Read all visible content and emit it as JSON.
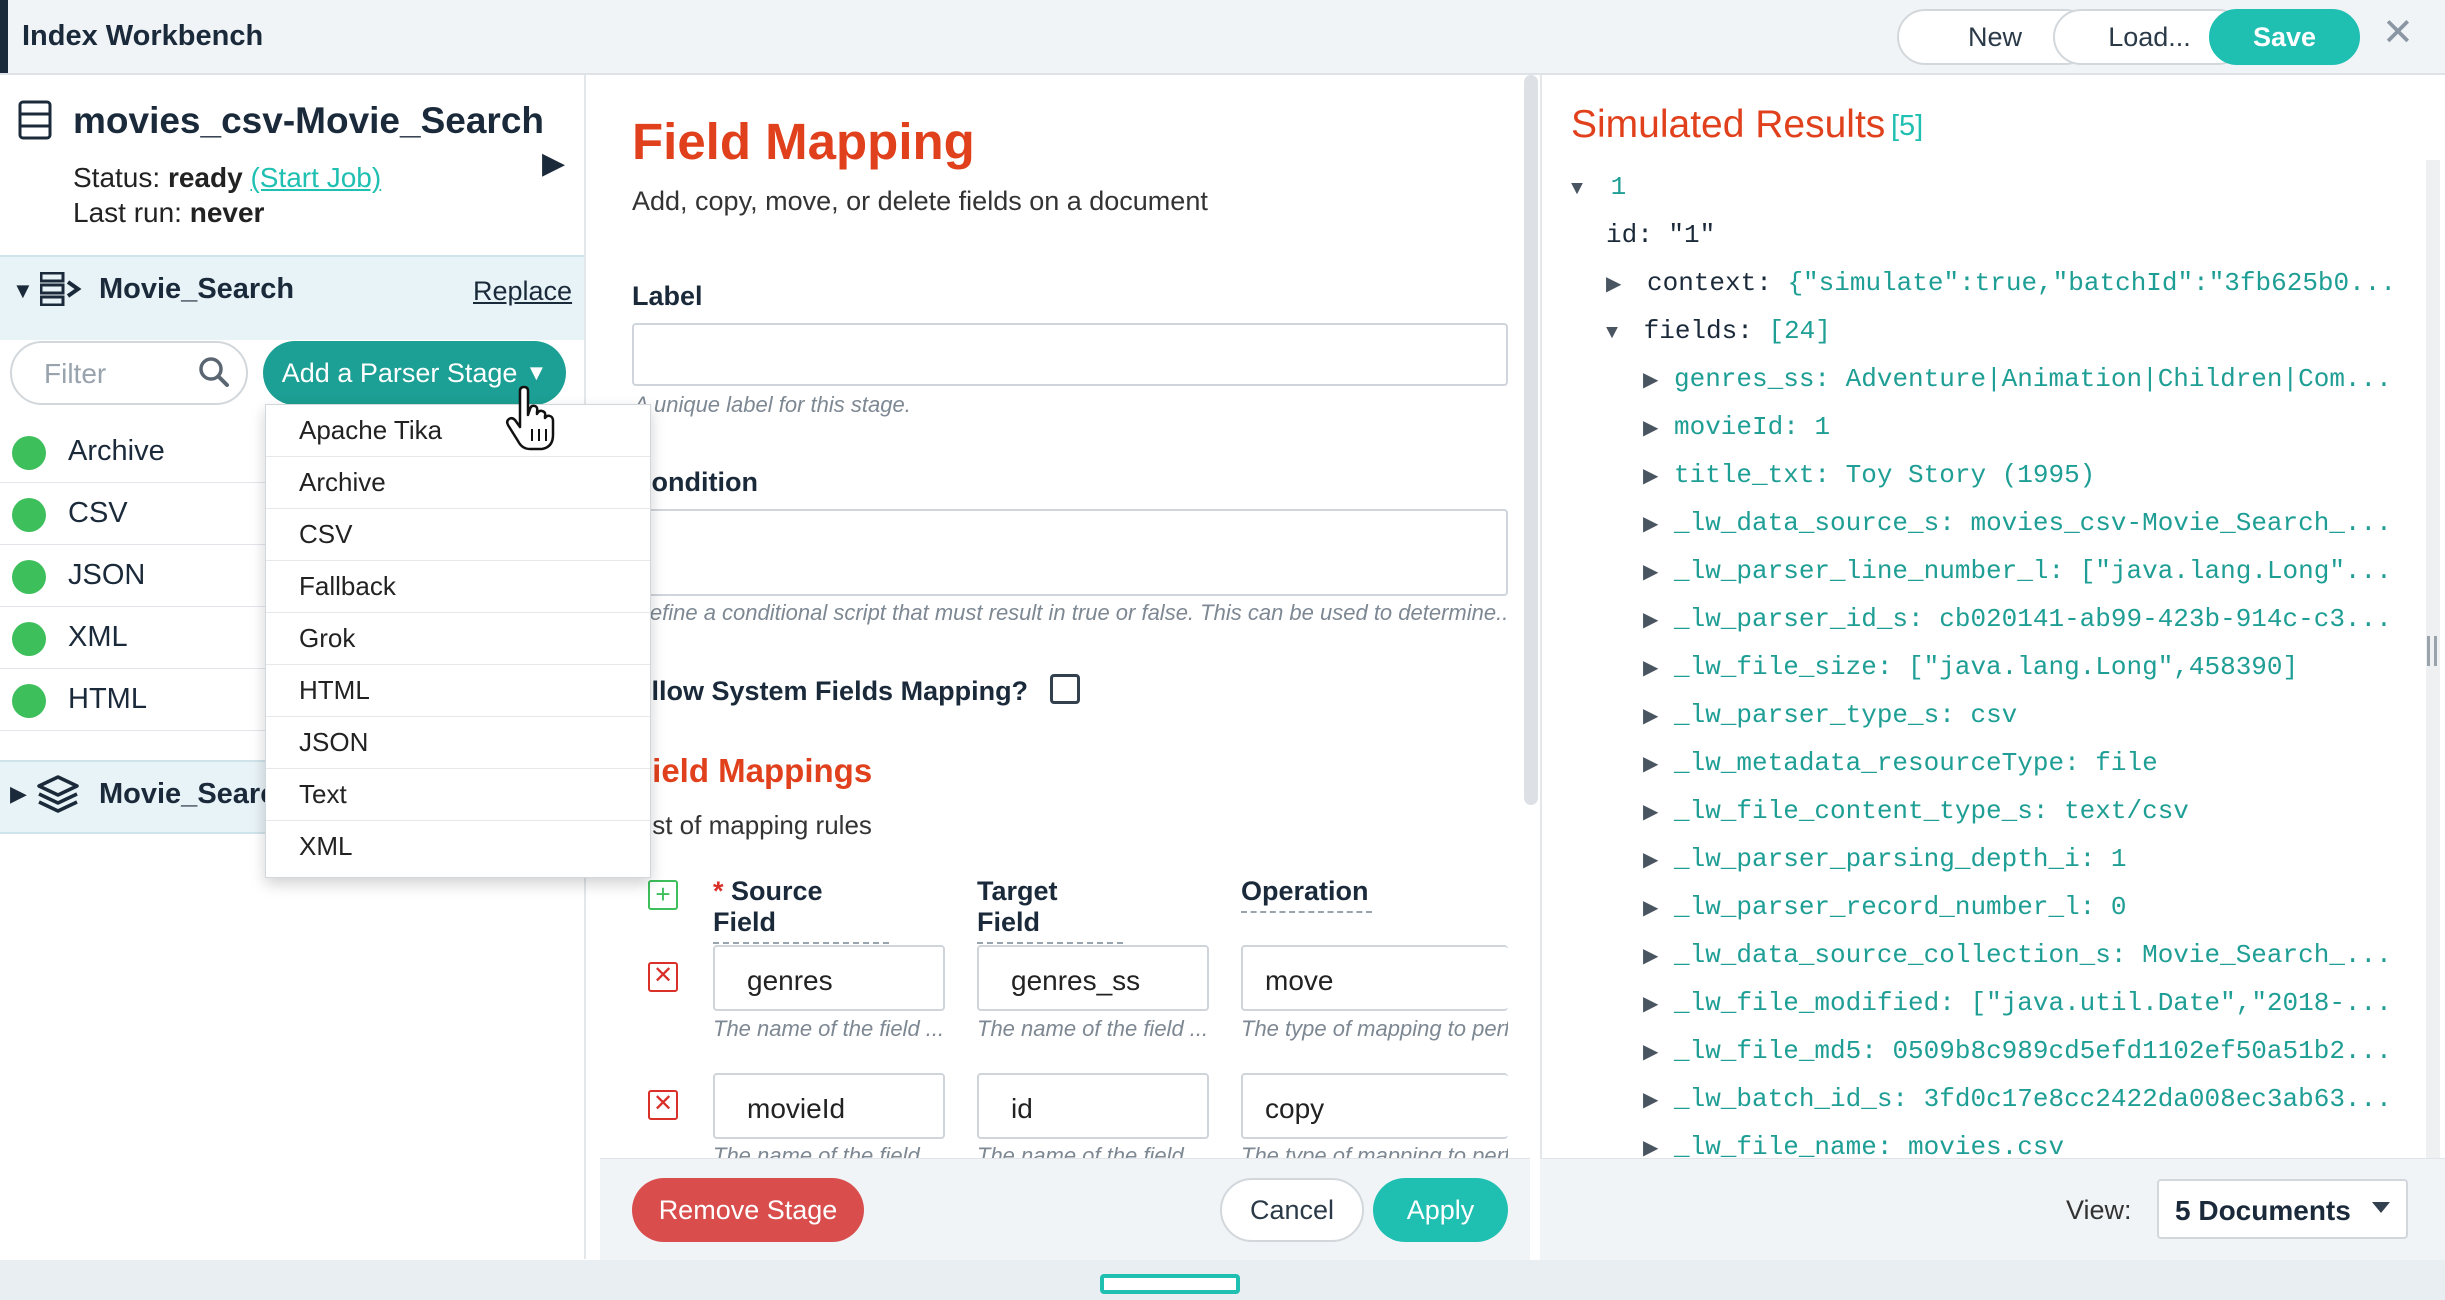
{
  "app": {
    "title": "Index Workbench"
  },
  "toolbar": {
    "new_label": "New",
    "load_label": "Load...",
    "save_label": "Save",
    "close_glyph": "✕"
  },
  "pipeline": {
    "name": "movies_csv-Movie_Search",
    "status_label": "Status:",
    "status_value": "ready",
    "start_job_link": "(Start Job)",
    "last_run_label": "Last run:",
    "last_run_value": "never",
    "collapse_glyph": "▶"
  },
  "parser_stage": {
    "name": "Movie_Search",
    "replace_label": "Replace",
    "filter_placeholder": "Filter",
    "add_button_label": "Add a Parser Stage",
    "items": [
      "Archive",
      "CSV",
      "JSON",
      "XML",
      "HTML"
    ],
    "item_status_color": "#3dbf5b"
  },
  "index_stage": {
    "name": "Movie_Search"
  },
  "dropdown": {
    "options": [
      "Apache Tika",
      "Archive",
      "CSV",
      "Fallback",
      "Grok",
      "HTML",
      "JSON",
      "Text",
      "XML"
    ]
  },
  "field_mapping": {
    "title": "Field Mapping",
    "subtitle": "Add, copy, move, or delete fields on a document",
    "label_field": {
      "label": "Label",
      "value": "",
      "hint": "A unique label for this stage."
    },
    "condition_field": {
      "label": "Condition",
      "value": "",
      "hint": "Define a conditional script that must result in true or false. This can be used to determine..."
    },
    "system_fields_label": "Allow System Fields Mapping?",
    "system_fields_checked": false,
    "mappings_heading": "Field Mappings",
    "mappings_subtitle": "List of mapping rules",
    "columns": {
      "required_mark": "*",
      "source": "Source Field",
      "target": "Target Field",
      "operation": "Operation"
    },
    "rows": [
      {
        "source": "genres",
        "target": "genres_ss",
        "operation": "move",
        "source_hint": "The name of the field ...",
        "target_hint": "The name of the field ...",
        "operation_hint": "The type of mapping to perform"
      },
      {
        "source": "movieId",
        "target": "id",
        "operation": "copy",
        "source_hint": "The name of the field",
        "target_hint": "The name of the field",
        "operation_hint": "The type of mapping to perform"
      }
    ],
    "remove_label": "Remove Stage",
    "cancel_label": "Cancel",
    "apply_label": "Apply"
  },
  "simulated": {
    "title": "Simulated Results",
    "count": "[5]",
    "doc_index": "1",
    "id_line": {
      "key": "id:",
      "value": "\"1\""
    },
    "context_line": {
      "key": "context:",
      "value": "{\"simulate\":true,\"batchId\":\"3fb625b0..."
    },
    "fields_line": {
      "key": "fields:",
      "value": "[24]"
    },
    "fields": [
      {
        "key": "genres_ss:",
        "value": "Adventure|Animation|Children|Com..."
      },
      {
        "key": "movieId:",
        "value": "1"
      },
      {
        "key": "title_txt:",
        "value": "Toy Story (1995)"
      },
      {
        "key": "_lw_data_source_s:",
        "value": "movies_csv-Movie_Search_..."
      },
      {
        "key": "_lw_parser_line_number_l:",
        "value": "[\"java.lang.Long\"..."
      },
      {
        "key": "_lw_parser_id_s:",
        "value": "cb020141-ab99-423b-914c-c3..."
      },
      {
        "key": "_lw_file_size:",
        "value": "[\"java.lang.Long\",458390]"
      },
      {
        "key": "_lw_parser_type_s:",
        "value": "csv"
      },
      {
        "key": "_lw_metadata_resourceType:",
        "value": "file"
      },
      {
        "key": "_lw_file_content_type_s:",
        "value": "text/csv"
      },
      {
        "key": "_lw_parser_parsing_depth_i:",
        "value": "1"
      },
      {
        "key": "_lw_parser_record_number_l:",
        "value": "0"
      },
      {
        "key": "_lw_data_source_collection_s:",
        "value": "Movie_Search_..."
      },
      {
        "key": "_lw_file_modified:",
        "value": "[\"java.util.Date\",\"2018-..."
      },
      {
        "key": "_lw_file_md5:",
        "value": "0509b8c989cd5efd1102ef50a51b2..."
      },
      {
        "key": "_lw_batch_id_s:",
        "value": "3fd0c17e8cc2422da008ec3ab63..."
      },
      {
        "key": "_lw_file_name:",
        "value": "movies.csv"
      }
    ],
    "view_label": "View:",
    "view_value": "5 Documents"
  },
  "colors": {
    "accent": "#1fbfb2",
    "heading": "#e0401c",
    "danger": "#d94d4d",
    "navy": "#1b2a3a"
  }
}
